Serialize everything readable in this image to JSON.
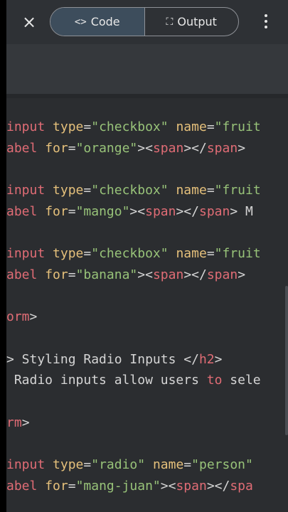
{
  "header": {
    "close_icon": "×",
    "tabs": [
      {
        "icon": "<>",
        "label": "Code",
        "active": true
      },
      {
        "icon": "⛶",
        "label": "Output",
        "active": false
      }
    ]
  },
  "colors": {
    "tag": "#e06c75",
    "attr": "#e5c07b",
    "string": "#98c379",
    "text": "#d5d5d5",
    "comment": "#8a8f98"
  },
  "code": {
    "lines": [
      {
        "segments": [
          {
            "t": "input",
            "c": "tag"
          },
          {
            "t": " "
          },
          {
            "t": "type",
            "c": "attr"
          },
          {
            "t": "=",
            "c": "text"
          },
          {
            "t": "\"checkbox\"",
            "c": "string"
          },
          {
            "t": " "
          },
          {
            "t": "name",
            "c": "attr"
          },
          {
            "t": "=",
            "c": "text"
          },
          {
            "t": "\"fruit",
            "c": "string"
          }
        ]
      },
      {
        "segments": [
          {
            "t": "abel",
            "c": "tag"
          },
          {
            "t": " "
          },
          {
            "t": "for",
            "c": "attr"
          },
          {
            "t": "=",
            "c": "text"
          },
          {
            "t": "\"orange\"",
            "c": "string"
          },
          {
            "t": "><",
            "c": "text"
          },
          {
            "t": "span",
            "c": "tag"
          },
          {
            "t": "></",
            "c": "text"
          },
          {
            "t": "span",
            "c": "tag"
          },
          {
            "t": ">",
            "c": "text"
          }
        ]
      },
      {
        "segments": []
      },
      {
        "segments": [
          {
            "t": "input",
            "c": "tag"
          },
          {
            "t": " "
          },
          {
            "t": "type",
            "c": "attr"
          },
          {
            "t": "=",
            "c": "text"
          },
          {
            "t": "\"checkbox\"",
            "c": "string"
          },
          {
            "t": " "
          },
          {
            "t": "name",
            "c": "attr"
          },
          {
            "t": "=",
            "c": "text"
          },
          {
            "t": "\"fruit",
            "c": "string"
          }
        ]
      },
      {
        "segments": [
          {
            "t": "abel",
            "c": "tag"
          },
          {
            "t": " "
          },
          {
            "t": "for",
            "c": "attr"
          },
          {
            "t": "=",
            "c": "text"
          },
          {
            "t": "\"mango\"",
            "c": "string"
          },
          {
            "t": "><",
            "c": "text"
          },
          {
            "t": "span",
            "c": "tag"
          },
          {
            "t": "></",
            "c": "text"
          },
          {
            "t": "span",
            "c": "tag"
          },
          {
            "t": "> M",
            "c": "text"
          }
        ]
      },
      {
        "segments": []
      },
      {
        "segments": [
          {
            "t": "input",
            "c": "tag"
          },
          {
            "t": " "
          },
          {
            "t": "type",
            "c": "attr"
          },
          {
            "t": "=",
            "c": "text"
          },
          {
            "t": "\"checkbox\"",
            "c": "string"
          },
          {
            "t": " "
          },
          {
            "t": "name",
            "c": "attr"
          },
          {
            "t": "=",
            "c": "text"
          },
          {
            "t": "\"fruit",
            "c": "string"
          }
        ]
      },
      {
        "segments": [
          {
            "t": "abel",
            "c": "tag"
          },
          {
            "t": " "
          },
          {
            "t": "for",
            "c": "attr"
          },
          {
            "t": "=",
            "c": "text"
          },
          {
            "t": "\"banana\"",
            "c": "string"
          },
          {
            "t": "><",
            "c": "text"
          },
          {
            "t": "span",
            "c": "tag"
          },
          {
            "t": "></",
            "c": "text"
          },
          {
            "t": "span",
            "c": "tag"
          },
          {
            "t": ">",
            "c": "text"
          }
        ]
      },
      {
        "segments": []
      },
      {
        "segments": [
          {
            "t": "orm",
            "c": "tag"
          },
          {
            "t": ">",
            "c": "text"
          }
        ]
      },
      {
        "segments": []
      },
      {
        "segments": [
          {
            "t": "> Styling Radio Inputs </",
            "c": "text"
          },
          {
            "t": "h2",
            "c": "tag"
          },
          {
            "t": ">",
            "c": "text"
          }
        ]
      },
      {
        "segments": [
          {
            "t": " Radio inputs allow users ",
            "c": "text"
          },
          {
            "t": "to",
            "c": "tag"
          },
          {
            "t": " sele",
            "c": "text"
          }
        ]
      },
      {
        "segments": []
      },
      {
        "segments": [
          {
            "t": "rm",
            "c": "tag"
          },
          {
            "t": ">",
            "c": "text"
          }
        ]
      },
      {
        "segments": []
      },
      {
        "segments": [
          {
            "t": "input",
            "c": "tag"
          },
          {
            "t": " "
          },
          {
            "t": "type",
            "c": "attr"
          },
          {
            "t": "=",
            "c": "text"
          },
          {
            "t": "\"radio\"",
            "c": "string"
          },
          {
            "t": " "
          },
          {
            "t": "name",
            "c": "attr"
          },
          {
            "t": "=",
            "c": "text"
          },
          {
            "t": "\"person\"",
            "c": "string"
          }
        ]
      },
      {
        "segments": [
          {
            "t": "abel",
            "c": "tag"
          },
          {
            "t": " "
          },
          {
            "t": "for",
            "c": "attr"
          },
          {
            "t": "=",
            "c": "text"
          },
          {
            "t": "\"mang-juan\"",
            "c": "string"
          },
          {
            "t": "><",
            "c": "text"
          },
          {
            "t": "span",
            "c": "tag"
          },
          {
            "t": "></",
            "c": "text"
          },
          {
            "t": "spa",
            "c": "tag"
          }
        ]
      }
    ]
  }
}
